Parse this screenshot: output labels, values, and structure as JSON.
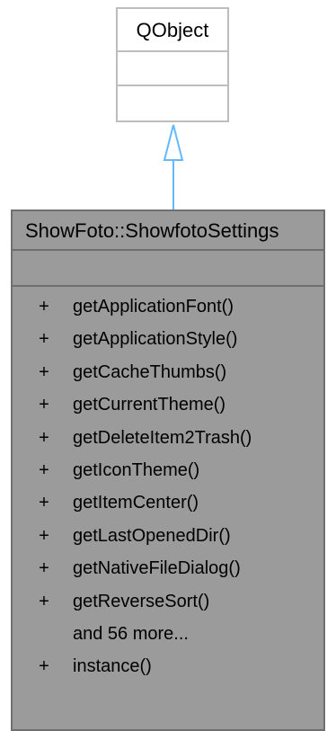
{
  "base_class": {
    "name": "QObject"
  },
  "derived_class": {
    "name": "ShowFoto::ShowfotoSettings",
    "methods": [
      {
        "visibility": "+",
        "name": "getApplicationFont()"
      },
      {
        "visibility": "+",
        "name": "getApplicationStyle()"
      },
      {
        "visibility": "+",
        "name": "getCacheThumbs()"
      },
      {
        "visibility": "+",
        "name": "getCurrentTheme()"
      },
      {
        "visibility": "+",
        "name": "getDeleteItem2Trash()"
      },
      {
        "visibility": "+",
        "name": "getIconTheme()"
      },
      {
        "visibility": "+",
        "name": "getItemCenter()"
      },
      {
        "visibility": "+",
        "name": "getLastOpenedDir()"
      },
      {
        "visibility": "+",
        "name": "getNativeFileDialog()"
      },
      {
        "visibility": "+",
        "name": "getReverseSort()"
      },
      {
        "visibility": "",
        "name": "and 56 more..."
      },
      {
        "visibility": "+",
        "name": "instance()"
      }
    ]
  },
  "colors": {
    "derived_fill": "#9b9b9b",
    "derived_border": "#6f6f6f",
    "base_border": "#bdbdbd",
    "arrow": "#63b8ff"
  }
}
